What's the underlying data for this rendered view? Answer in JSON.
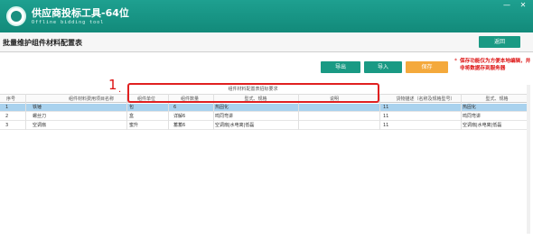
{
  "app": {
    "title": "供应商投标工具-64位",
    "subtitle": "Offline bidding tool"
  },
  "window_controls": {
    "minimize": "—",
    "close": "✕"
  },
  "page": {
    "title": "批量维护组件材料配置表",
    "back_label": "返回"
  },
  "toolbar": {
    "export_label": "导出",
    "import_label": "导入",
    "save_label": "保存",
    "notice_star": "*",
    "notice": "保存功能仅为方便本地编辑，并非将数据存到服务器"
  },
  "annotation": {
    "number": "1",
    "dot": "."
  },
  "table": {
    "group_header": "组件材料配置表招标要求",
    "columns": [
      "序号",
      "组件材料费用项目名称",
      "组件单位",
      "组件数量",
      "型式、规格",
      "说明",
      "货物描述（名称及规格型号）",
      "型式、规格"
    ],
    "rows": [
      {
        "cells": [
          "1",
          "铁锤",
          "包",
          "6",
          "热固化",
          "",
          "11",
          "热固化"
        ],
        "selected": true
      },
      {
        "cells": [
          "2",
          "螺丝刀",
          "盒",
          "详解6",
          "鸣同弯讲",
          "",
          "11",
          "鸣同弯讲"
        ],
        "selected": false
      },
      {
        "cells": [
          "3",
          "空调扇",
          "蜜升",
          "蓄蓄6",
          "空调扇|水电离|低磊",
          "",
          "11",
          "空调扇|水电离|低磊"
        ],
        "selected": false
      }
    ]
  },
  "colors": {
    "title_bar": "#1a9a84",
    "accent": "#1a9a84",
    "save": "#f4a93c",
    "notice": "#d11111",
    "selected_row": "#a9d2ee"
  }
}
